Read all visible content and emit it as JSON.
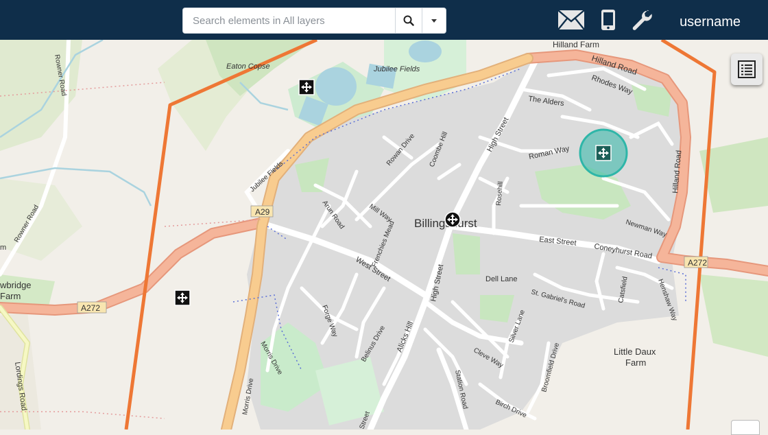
{
  "header": {
    "search_placeholder": "Search elements in All layers",
    "username": "username",
    "icons": [
      "search-icon",
      "chevron-down-icon",
      "mail-icon",
      "mobile-icon",
      "wrench-icon"
    ]
  },
  "map": {
    "place_label": "Billingshurst",
    "labels": {
      "hilland_farm": "Hilland Farm",
      "hilland_road": "Hilland Road",
      "hilland_road_v": "Hilland Road",
      "rhodes_way": "Rhodes Way",
      "the_alders": "The Alders",
      "roman_way": "Roman Way",
      "eaton_copse": "Eaton Copse",
      "jubilee_fields_park": "Jubilee Fields",
      "jubilee_fields": "Jubilee Fields",
      "rowner_road_n": "Rowner Road",
      "rowner_road_s": "Rowner Road",
      "a29": "A29",
      "a272": "A272",
      "a272_e": "A272",
      "rowan_drive": "Rowan Drive",
      "coombe_hill": "Coombe Hill",
      "high_street_n": "High Street",
      "high_street_s": "High Street",
      "rosehill": "Rosehill",
      "mill_way": "Mill Way",
      "arun_road": "Arun Road",
      "frenchies_mead": "Frenchies Mead",
      "west_street": "West Street",
      "east_street": "East Street",
      "coneyhurst_road": "Coneyhurst Road",
      "newman_way": "Newman Way",
      "dell_lane": "Dell Lane",
      "st_gabriels_road": "St. Gabriel's Road",
      "catsfield": "Catsfield",
      "henshaw_way": "Henshaw Way",
      "little_daux_farm_1": "Little Daux",
      "little_daux_farm_2": "Farm",
      "forge_way": "Forge Way",
      "morris_drive_1": "Morris Drive",
      "morris_drive_2": "Morris Drive",
      "belinus_drive": "Belinus Drive",
      "alicks_hill": "Alicks Hill",
      "silver_lane": "Silver Lane",
      "cleve_way": "Cleve Way",
      "broomfield_drive": "Broomfield Drive",
      "station_road": "Station Road",
      "birch_drive": "Birch Drive",
      "lordings_road": "Lordings Road",
      "rowbridge_farm_1": "wbridge",
      "rowbridge_farm_2": "Farm",
      "m_stub": "m",
      "street_stub": "Street"
    },
    "markers": [
      "pan-marker-1",
      "pan-marker-2",
      "center-marker",
      "selected-marker"
    ],
    "colors": {
      "boundary": "#ee7735",
      "selected": "#2eb6a8",
      "a_road": "#f0a07f",
      "main_road": "#f7c788",
      "urban": "#dddddd",
      "park": "#c8ebc6"
    }
  },
  "layers_button": {
    "icon": "list-icon"
  }
}
